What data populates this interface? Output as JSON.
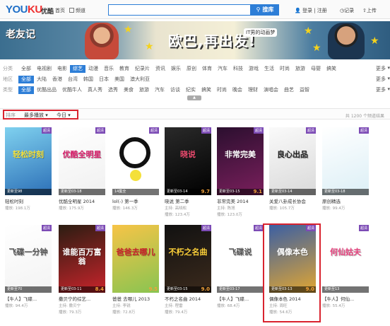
{
  "header": {
    "logo": "YOUKU",
    "logo_cn": "优酷",
    "home": "首页",
    "channels": "频道",
    "search_placeholder": "",
    "search_button": "搜库",
    "user_links": "登录 | 注册",
    "record": "记录",
    "upload": "上传"
  },
  "banner": {
    "show_title": "老友记",
    "slogan": "欧巴,再出发!",
    "subtitle": "IT男的动画梦",
    "colors": {
      "sky": "#4b7da0",
      "star": "#f4d21d"
    }
  },
  "filters": {
    "rows": [
      {
        "label": "分类",
        "items": [
          "全部",
          "电视剧",
          "电影",
          "综艺",
          "动漫",
          "音乐",
          "教育",
          "纪录片",
          "资讯",
          "娱乐",
          "原创",
          "体育",
          "汽车",
          "科技",
          "游戏",
          "生活",
          "时尚",
          "旅游",
          "母婴",
          "搞笑"
        ],
        "selected": 3
      },
      {
        "label": "地区",
        "items": [
          "全部",
          "大陆",
          "香港",
          "台湾",
          "韩国",
          "日本",
          "美国",
          "澳大利亚"
        ],
        "selected": 0
      },
      {
        "label": "类型",
        "items": [
          "全部",
          "优酷出品",
          "优酷牛人",
          "真人秀",
          "选秀",
          "美食",
          "旅游",
          "汽车",
          "访谈",
          "纪实",
          "搞笑",
          "时尚",
          "晚会",
          "理财",
          "演唱会",
          "曲艺",
          "益智"
        ],
        "selected": 0
      }
    ],
    "more": "更多"
  },
  "sort": {
    "label": "排序",
    "order": "最多播放",
    "period": "今日",
    "count": "共 1200 个频道结果"
  },
  "cards": [
    {
      "title": "轻松时刻",
      "update": "更新至98",
      "score": "",
      "host": "",
      "plays": "播放: 198.1万",
      "badge": "超清",
      "art": "轻松时刻"
    },
    {
      "title": "优酷全明星 2014",
      "update": "更新至03-18",
      "score": "",
      "host": "",
      "plays": "播放: 175.9万",
      "badge": "超清",
      "art": "优酷全明星"
    },
    {
      "title": "lol(-) 第一季",
      "update": "14集全",
      "score": "",
      "host": "",
      "plays": "播放: 146.3万",
      "badge": "超清",
      "art": ""
    },
    {
      "title": "晓说 第二季",
      "update": "更新至03-14",
      "score": "9.7",
      "host": "主持: 高晓松",
      "plays": "播放: 123.4万",
      "badge": "超清",
      "art": "晓说"
    },
    {
      "title": "非常完美 2014",
      "update": "更新至03-15",
      "score": "9.1",
      "host": "主持: 陈旭",
      "plays": "播放: 123.0万",
      "badge": "超清",
      "art": "非常完美"
    },
    {
      "title": "关爱八卦成长协会",
      "update": "更新至03-14",
      "score": "",
      "host": "",
      "plays": "播放: 105.7万",
      "badge": "超清",
      "art": "良心出品"
    },
    {
      "title": "原创精选",
      "update": "更新至03-18",
      "score": "",
      "host": "",
      "plays": "播放: 99.4万",
      "badge": "超清",
      "art": ""
    },
    {
      "title": "【牛人】飞碟...",
      "update": "更新至70",
      "score": "",
      "host": "",
      "plays": "播放: 94.4万",
      "badge": "超清",
      "art": "飞碟一分钟"
    },
    {
      "title": "撒贝宁的综艺...",
      "update": "更新至03-11",
      "score": "8.4",
      "host": "主持: 撒贝宁",
      "plays": "播放: 79.3万",
      "badge": "超清",
      "art": "谁能百万富翁"
    },
    {
      "title": "爸爸 去哪儿 2013",
      "update": "",
      "score": "9.5",
      "host": "主持: 李锐",
      "plays": "播放: 72.8万",
      "badge": "",
      "art": "爸爸去哪儿"
    },
    {
      "title": "不朽之名曲 2014",
      "update": "更新至03-15",
      "score": "9.0",
      "host": "主持: 程雷",
      "plays": "播放: 79.4万",
      "badge": "超清",
      "art": "不朽之名曲"
    },
    {
      "title": "【牛人】飞碟...",
      "update": "更新至03-17",
      "score": "",
      "host": "",
      "plays": "播放: 68.4万",
      "badge": "超清",
      "art": "飞碟说"
    },
    {
      "title": "偶像本色 2014",
      "update": "更新至03-13",
      "score": "9.0",
      "host": "主持: 周旺",
      "plays": "播放: 54.6万",
      "badge": "超清",
      "art": "偶像本色"
    },
    {
      "title": "【牛人】何仙...",
      "update": "更新至13",
      "score": "",
      "host": "",
      "plays": "播放: 55.4万",
      "badge": "超清",
      "art": "何仙姑夫"
    }
  ]
}
